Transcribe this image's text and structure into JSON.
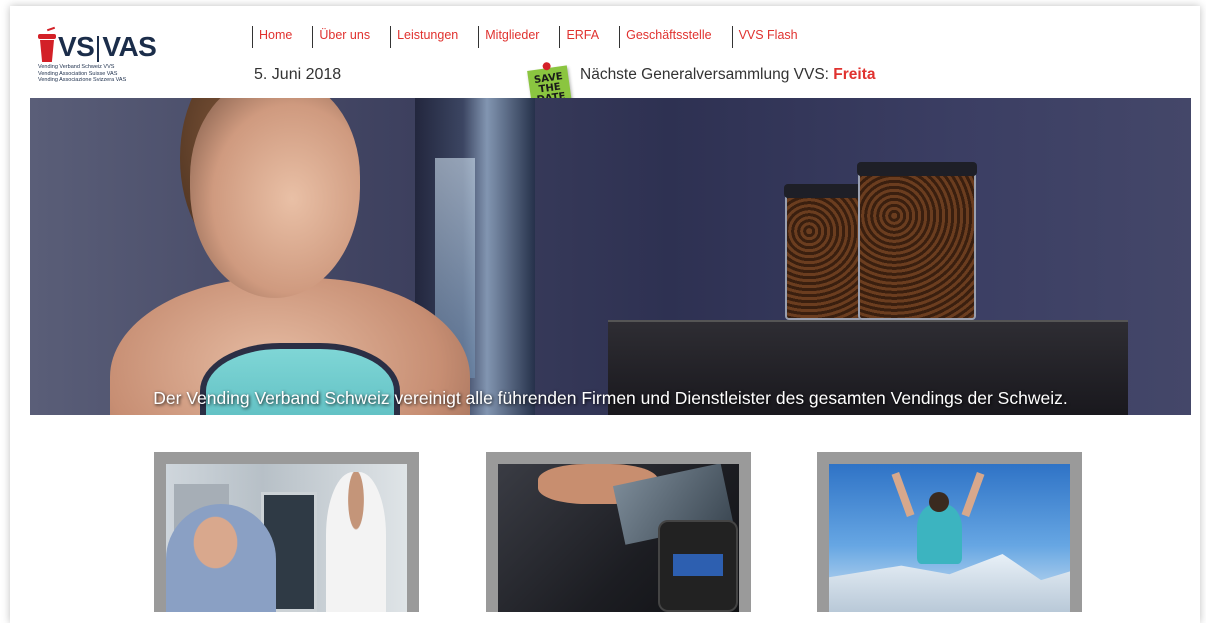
{
  "logo": {
    "text_left": "VS",
    "text_right": "VAS",
    "subtitle_lines": [
      "Vending Verband Schweiz VVS",
      "Vending Association Suisse VAS",
      "Vending Associazione Svizzera VAS"
    ],
    "brand_color": "#d32027",
    "text_color": "#1b2d4a"
  },
  "nav": {
    "items": [
      {
        "label": "Home"
      },
      {
        "label": "Über uns"
      },
      {
        "label": "Leistungen"
      },
      {
        "label": "Mitglieder"
      },
      {
        "label": "ERFA"
      },
      {
        "label": "Geschäftsstelle"
      },
      {
        "label": "VVS Flash"
      }
    ],
    "link_color": "#e0322f"
  },
  "header": {
    "date": "5. Juni 2018",
    "save_the_date": [
      "SAVE",
      "THE",
      "DATE"
    ],
    "ticker_text": "Nächste Generalversammlung VVS: ",
    "ticker_highlight": "Freita"
  },
  "hero": {
    "caption": "Der Vending Verband Schweiz vereinigt alle führenden Firmen und Dienstleister des gesamten Vendings der Schweiz."
  },
  "cards": [
    {
      "image": "people-at-vending-machine"
    },
    {
      "image": "card-payment-terminal"
    },
    {
      "image": "man-on-mountain"
    }
  ]
}
